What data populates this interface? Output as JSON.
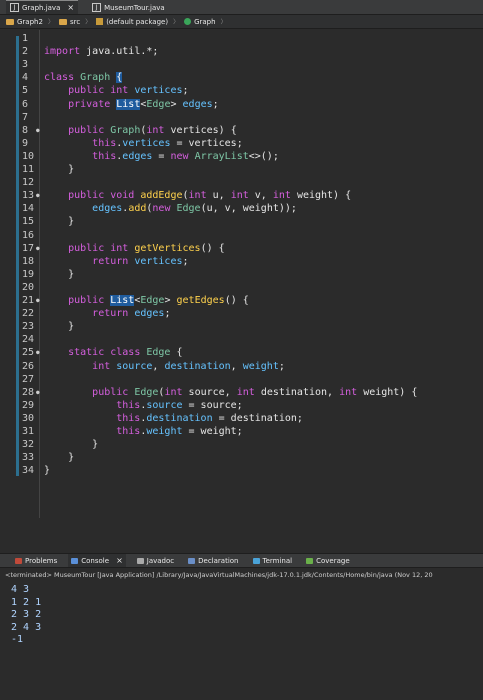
{
  "file_tabs": [
    {
      "label": "Graph.java",
      "active": true,
      "close": "×"
    },
    {
      "label": "MuseumTour.java",
      "active": false,
      "close": ""
    }
  ],
  "breadcrumb": [
    "Graph2",
    "src",
    "(default package)",
    "Graph"
  ],
  "breadcrumb_sep": "〉",
  "code": [
    {
      "n": "1",
      "fold": false,
      "parts": []
    },
    {
      "n": "2",
      "fold": false,
      "parts": [
        [
          "kw",
          "import "
        ],
        [
          "",
          "java.util.*;"
        ]
      ]
    },
    {
      "n": "3",
      "fold": false,
      "parts": []
    },
    {
      "n": "4",
      "fold": false,
      "parts": [
        [
          "kw",
          "class "
        ],
        [
          "typ",
          "Graph "
        ],
        [
          "hl",
          "{"
        ]
      ]
    },
    {
      "n": "5",
      "fold": false,
      "parts": [
        [
          "",
          "    "
        ],
        [
          "kw",
          "public int "
        ],
        [
          "fld",
          "vertices"
        ],
        [
          "",
          ";"
        ]
      ]
    },
    {
      "n": "6",
      "fold": false,
      "parts": [
        [
          "",
          "    "
        ],
        [
          "kw",
          "private "
        ],
        [
          "hl",
          "List"
        ],
        [
          "",
          "<"
        ],
        [
          "typ",
          "Edge"
        ],
        [
          "",
          "> "
        ],
        [
          "fld",
          "edges"
        ],
        [
          "",
          ";"
        ]
      ]
    },
    {
      "n": "7",
      "fold": false,
      "parts": []
    },
    {
      "n": "8",
      "fold": true,
      "parts": [
        [
          "",
          "    "
        ],
        [
          "kw",
          "public "
        ],
        [
          "typ",
          "Graph"
        ],
        [
          "",
          "("
        ],
        [
          "kw",
          "int "
        ],
        [
          "",
          "vertices) {"
        ]
      ]
    },
    {
      "n": "9",
      "fold": false,
      "parts": [
        [
          "",
          "        "
        ],
        [
          "kw",
          "this"
        ],
        [
          "",
          "."
        ],
        [
          "fld",
          "vertices"
        ],
        [
          "",
          " = vertices;"
        ]
      ]
    },
    {
      "n": "10",
      "fold": false,
      "parts": [
        [
          "",
          "        "
        ],
        [
          "kw",
          "this"
        ],
        [
          "",
          "."
        ],
        [
          "fld",
          "edges"
        ],
        [
          "",
          " = "
        ],
        [
          "kw",
          "new "
        ],
        [
          "typ",
          "ArrayList"
        ],
        [
          "",
          "<>();"
        ]
      ]
    },
    {
      "n": "11",
      "fold": false,
      "parts": [
        [
          "",
          "    }"
        ]
      ]
    },
    {
      "n": "12",
      "fold": false,
      "parts": []
    },
    {
      "n": "13",
      "fold": true,
      "parts": [
        [
          "",
          "    "
        ],
        [
          "kw",
          "public void "
        ],
        [
          "mth",
          "addEdge"
        ],
        [
          "",
          "("
        ],
        [
          "kw",
          "int "
        ],
        [
          "",
          "u, "
        ],
        [
          "kw",
          "int "
        ],
        [
          "",
          "v, "
        ],
        [
          "kw",
          "int "
        ],
        [
          "",
          "weight) {"
        ]
      ]
    },
    {
      "n": "14",
      "fold": false,
      "parts": [
        [
          "",
          "        "
        ],
        [
          "fld",
          "edges"
        ],
        [
          "",
          "."
        ],
        [
          "mth",
          "add"
        ],
        [
          "",
          "("
        ],
        [
          "kw",
          "new "
        ],
        [
          "typ",
          "Edge"
        ],
        [
          "",
          "(u, v, weight));"
        ]
      ]
    },
    {
      "n": "15",
      "fold": false,
      "parts": [
        [
          "",
          "    }"
        ]
      ]
    },
    {
      "n": "16",
      "fold": false,
      "parts": []
    },
    {
      "n": "17",
      "fold": true,
      "parts": [
        [
          "",
          "    "
        ],
        [
          "kw",
          "public int "
        ],
        [
          "mth",
          "getVertices"
        ],
        [
          "",
          "() {"
        ]
      ]
    },
    {
      "n": "18",
      "fold": false,
      "parts": [
        [
          "",
          "        "
        ],
        [
          "kw",
          "return "
        ],
        [
          "fld",
          "vertices"
        ],
        [
          "",
          ";"
        ]
      ]
    },
    {
      "n": "19",
      "fold": false,
      "parts": [
        [
          "",
          "    }"
        ]
      ]
    },
    {
      "n": "20",
      "fold": false,
      "parts": []
    },
    {
      "n": "21",
      "fold": true,
      "parts": [
        [
          "",
          "    "
        ],
        [
          "kw",
          "public "
        ],
        [
          "hl",
          "List"
        ],
        [
          "",
          "<"
        ],
        [
          "typ",
          "Edge"
        ],
        [
          "",
          "> "
        ],
        [
          "mth",
          "getEdges"
        ],
        [
          "",
          "() {"
        ]
      ]
    },
    {
      "n": "22",
      "fold": false,
      "parts": [
        [
          "",
          "        "
        ],
        [
          "kw",
          "return "
        ],
        [
          "fld",
          "edges"
        ],
        [
          "",
          ";"
        ]
      ]
    },
    {
      "n": "23",
      "fold": false,
      "parts": [
        [
          "",
          "    }"
        ]
      ]
    },
    {
      "n": "24",
      "fold": false,
      "parts": []
    },
    {
      "n": "25",
      "fold": true,
      "parts": [
        [
          "",
          "    "
        ],
        [
          "kw",
          "static class "
        ],
        [
          "typ",
          "Edge "
        ],
        [
          "",
          "{"
        ]
      ]
    },
    {
      "n": "26",
      "fold": false,
      "parts": [
        [
          "",
          "        "
        ],
        [
          "kw",
          "int "
        ],
        [
          "fld",
          "source"
        ],
        [
          "",
          ", "
        ],
        [
          "fld",
          "destination"
        ],
        [
          "",
          ", "
        ],
        [
          "fld",
          "weight"
        ],
        [
          "",
          ";"
        ]
      ]
    },
    {
      "n": "27",
      "fold": false,
      "parts": []
    },
    {
      "n": "28",
      "fold": true,
      "parts": [
        [
          "",
          "        "
        ],
        [
          "kw",
          "public "
        ],
        [
          "typ",
          "Edge"
        ],
        [
          "",
          "("
        ],
        [
          "kw",
          "int "
        ],
        [
          "",
          "source, "
        ],
        [
          "kw",
          "int "
        ],
        [
          "",
          "destination, "
        ],
        [
          "kw",
          "int "
        ],
        [
          "",
          "weight) {"
        ]
      ]
    },
    {
      "n": "29",
      "fold": false,
      "parts": [
        [
          "",
          "            "
        ],
        [
          "kw",
          "this"
        ],
        [
          "",
          "."
        ],
        [
          "fld",
          "source"
        ],
        [
          "",
          " = source;"
        ]
      ]
    },
    {
      "n": "30",
      "fold": false,
      "parts": [
        [
          "",
          "            "
        ],
        [
          "kw",
          "this"
        ],
        [
          "",
          "."
        ],
        [
          "fld",
          "destination"
        ],
        [
          "",
          " = destination;"
        ]
      ]
    },
    {
      "n": "31",
      "fold": false,
      "parts": [
        [
          "",
          "            "
        ],
        [
          "kw",
          "this"
        ],
        [
          "",
          "."
        ],
        [
          "fld",
          "weight"
        ],
        [
          "",
          " = weight;"
        ]
      ]
    },
    {
      "n": "32",
      "fold": false,
      "parts": [
        [
          "",
          "        }"
        ]
      ]
    },
    {
      "n": "33",
      "fold": false,
      "parts": [
        [
          "",
          "    }"
        ]
      ]
    },
    {
      "n": "34",
      "fold": false,
      "parts": [
        [
          "",
          "}"
        ]
      ]
    }
  ],
  "console_tabs": [
    {
      "label": "Problems",
      "icon": "problems-icon",
      "color": "#c04a3a",
      "active": false
    },
    {
      "label": "Console",
      "icon": "console-icon",
      "color": "#5a8fd8",
      "active": true,
      "close": "×"
    },
    {
      "label": "Javadoc",
      "icon": "javadoc-icon",
      "color": "#aaaaaa",
      "active": false
    },
    {
      "label": "Declaration",
      "icon": "declaration-icon",
      "color": "#6a8fc8",
      "active": false
    },
    {
      "label": "Terminal",
      "icon": "terminal-icon",
      "color": "#4aa3d8",
      "active": false
    },
    {
      "label": "Coverage",
      "icon": "coverage-icon",
      "color": "#6ab04a",
      "active": false
    }
  ],
  "console_status": "<terminated> MuseumTour [Java Application] /Library/Java/JavaVirtualMachines/jdk-17.0.1.jdk/Contents/Home/bin/java  (Nov 12, 20",
  "console_output": [
    "4 3",
    "1 2 1",
    "2 3 2",
    "2 4 3",
    "-1"
  ]
}
